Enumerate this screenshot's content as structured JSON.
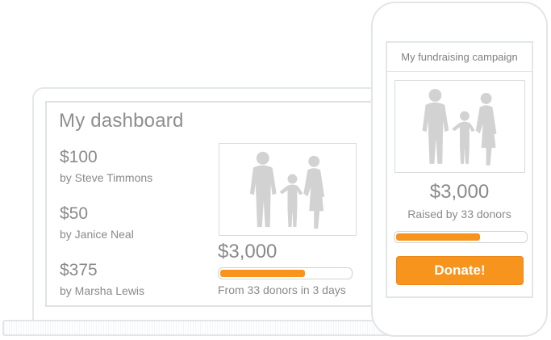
{
  "dashboard": {
    "title": "My dashboard",
    "donations": [
      {
        "amount": "$100",
        "donor": "by Steve Timmons"
      },
      {
        "amount": "$50",
        "donor": "by Janice Neal"
      },
      {
        "amount": "$375",
        "donor": "by Marsha Lewis"
      }
    ],
    "total": "$3,000",
    "progress_fraction": 0.66,
    "caption": "From 33 donors in 3 days"
  },
  "campaign": {
    "title": "My fundraising campaign",
    "total": "$3,000",
    "caption": "Raised by 33 donors",
    "progress_fraction": 0.66,
    "donate_label": "Donate!"
  },
  "colors": {
    "accent": "#f7941d",
    "silhouette": "#d2d2d2",
    "text": "#8a8a8a",
    "outline": "#e3e6e9"
  },
  "icons": {
    "campaign_photo": "family-silhouette-icon"
  }
}
